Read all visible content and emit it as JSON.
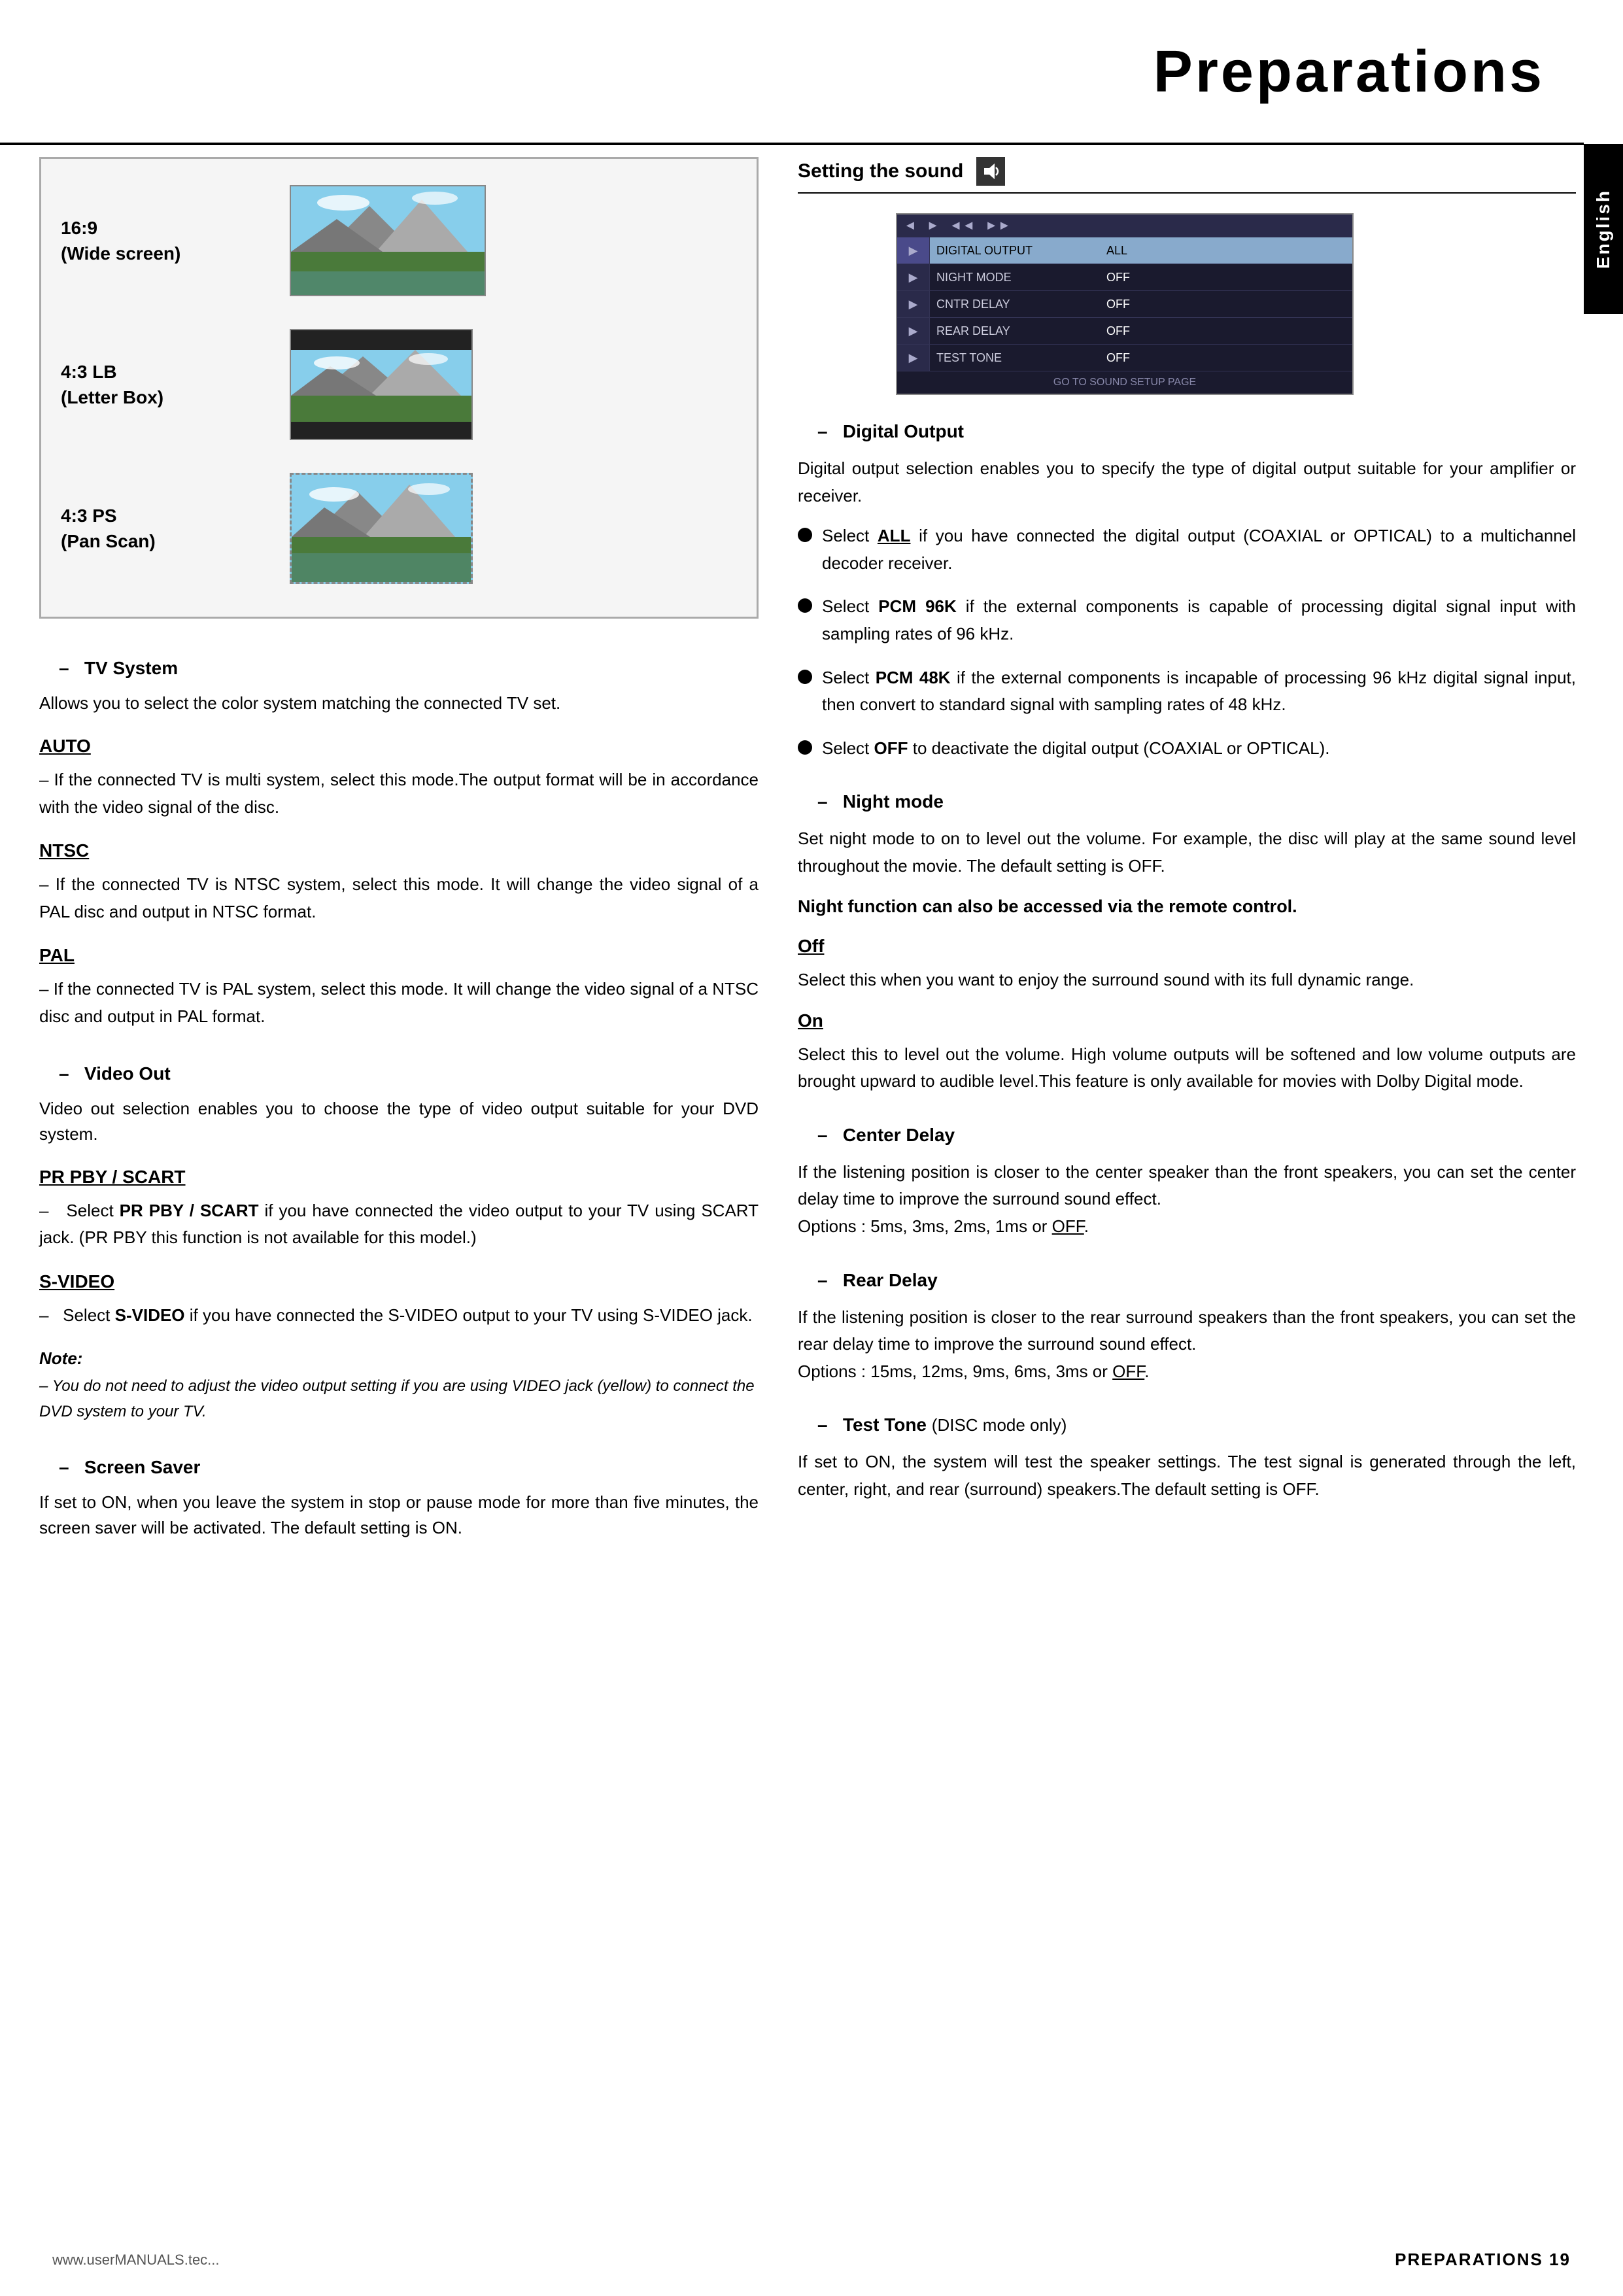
{
  "header": {
    "title": "Preparations"
  },
  "english_tab": {
    "label": "English"
  },
  "left_column": {
    "aspect_ratios": [
      {
        "label": "16:9\n(Wide screen)"
      },
      {
        "label": "4:3 LB\n(Letter Box)"
      },
      {
        "label": "4:3 PS\n(Pan Scan)"
      }
    ],
    "tv_system": {
      "title": "TV System",
      "body": "Allows you to select the color system matching the connected TV set.",
      "auto": {
        "title": "AUTO",
        "text": "–   If the connected TV is multi system, select this mode.The output format will be in accordance with the video signal of the disc."
      },
      "ntsc": {
        "title": "NTSC",
        "text": "–   If the connected TV is NTSC system, select this mode. It will change the video signal of a PAL disc and output in NTSC format."
      },
      "pal": {
        "title": "PAL",
        "text": "–   If the connected TV is PAL system, select this mode. It will change the video signal of a NTSC disc and output in PAL format."
      }
    },
    "video_out": {
      "title": "Video Out",
      "body": "Video out selection enables you to choose the type of video output suitable for your DVD system.",
      "prpby_scart": {
        "title": "PR PBY / SCART",
        "text": "–   Select PR PBY / SCART if you have connected the video output to your TV using SCART jack. (PR PBY this function is not available for this model.)"
      },
      "svideo": {
        "title": "S-VIDEO",
        "text": "–   Select S-VIDEO if you have connected the S-VIDEO output to your TV using S-VIDEO jack."
      },
      "note": {
        "title": "Note:",
        "text": "–   You do not need to adjust the video output setting if you are using VIDEO jack (yellow) to connect the DVD system to your TV."
      }
    },
    "screen_saver": {
      "title": "Screen Saver",
      "body": "If set to ON, when you leave the system in stop or pause mode for more than five minutes, the screen saver will be activated. The default setting is ON."
    }
  },
  "right_column": {
    "sound_header": "Setting the sound",
    "osd": {
      "rows": [
        {
          "label": "DIGITAL OUTPUT",
          "value": "ALL"
        },
        {
          "label": "NIGHT MODE",
          "value": "OFF"
        },
        {
          "label": "CNTR DELAY",
          "value": "OFF"
        },
        {
          "label": "REAR DELAY",
          "value": "OFF"
        },
        {
          "label": "TEST TONE",
          "value": "OFF"
        }
      ],
      "footer": "GO TO SOUND SETUP PAGE"
    },
    "digital_output": {
      "title": "Digital Output",
      "intro": "Digital output selection enables you to specify the type of digital output suitable for your amplifier or receiver.",
      "bullets": [
        "Select ALL if you have connected the digital output (COAXIAL or OPTICAL) to a multichannel decoder receiver.",
        "Select PCM 96K if the external components is capable of processing digital signal input with sampling rates of 96 kHz.",
        "Select PCM 48K if the external components is incapable of processing 96 kHz digital signal input, then convert to standard signal with sampling rates of 48 kHz.",
        "Select OFF to deactivate the digital output (COAXIAL or OPTICAL)."
      ]
    },
    "night_mode": {
      "title": "Night mode",
      "intro": "Set night mode to on to level out the volume.  For example, the disc will play at the same sound level throughout the movie. The default setting is OFF.",
      "bold_note": "Night function can also be accessed via the remote control.",
      "off": {
        "title": "Off",
        "text": "Select this when you want to enjoy the surround sound with its full dynamic range."
      },
      "on": {
        "title": "On",
        "text": "Select this to level out the volume. High volume outputs will be softened and low volume outputs are brought upward to audible level.This feature is only available for movies with Dolby Digital mode."
      }
    },
    "center_delay": {
      "title": "Center Delay",
      "text": "If the listening position is closer to the center speaker than the front speakers, you can set the center delay time to improve the surround sound effect.\nOptions : 5ms, 3ms, 2ms, 1ms or OFF."
    },
    "rear_delay": {
      "title": "Rear Delay",
      "text": "If the listening position is closer to the rear surround speakers than the front speakers, you can set the rear delay time to improve the surround sound effect.\nOptions : 15ms, 12ms, 9ms, 6ms, 3ms or OFF."
    },
    "test_tone": {
      "title": "Test Tone",
      "subtitle": "(DISC mode only)",
      "text": "If set to ON, the system will test the speaker settings.  The test signal is generated through the left, center, right, and rear (surround) speakers.The default setting is OFF."
    }
  },
  "footer": {
    "left": "www.userMANUALS.tec...",
    "right": "PREPARATIONS   19"
  }
}
